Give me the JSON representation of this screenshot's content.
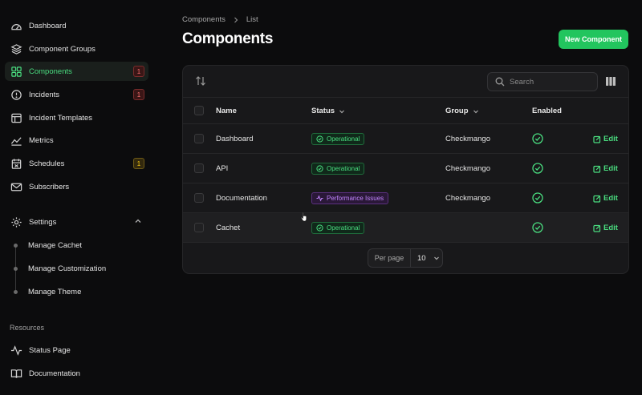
{
  "sidebar": {
    "items": [
      {
        "label": "Dashboard"
      },
      {
        "label": "Component Groups"
      },
      {
        "label": "Components",
        "badge": "1"
      },
      {
        "label": "Incidents",
        "badge": "1"
      },
      {
        "label": "Incident Templates"
      },
      {
        "label": "Metrics"
      },
      {
        "label": "Schedules",
        "badge": "1"
      },
      {
        "label": "Subscribers"
      }
    ],
    "settings": {
      "label": "Settings",
      "subitems": [
        {
          "label": "Manage Cachet"
        },
        {
          "label": "Manage Customization"
        },
        {
          "label": "Manage Theme"
        }
      ]
    },
    "resources": {
      "label": "Resources",
      "items": [
        {
          "label": "Status Page"
        },
        {
          "label": "Documentation"
        }
      ]
    }
  },
  "header": {
    "breadcrumb": [
      "Components",
      "List"
    ],
    "title": "Components",
    "new_button": "New Component"
  },
  "toolbar": {
    "search_placeholder": "Search"
  },
  "table": {
    "columns": [
      "Name",
      "Status",
      "Group",
      "Enabled"
    ],
    "rows": [
      {
        "name": "Dashboard",
        "status": "Operational",
        "group": "Checkmango",
        "enabled": true,
        "action": "Edit"
      },
      {
        "name": "API",
        "status": "Operational",
        "group": "Checkmango",
        "enabled": true,
        "action": "Edit"
      },
      {
        "name": "Documentation",
        "status": "Performance Issues",
        "group": "Checkmango",
        "enabled": true,
        "action": "Edit"
      },
      {
        "name": "Cachet",
        "status": "Operational",
        "group": "",
        "enabled": true,
        "action": "Edit"
      }
    ]
  },
  "pagination": {
    "label": "Per page",
    "value": "10"
  },
  "colors": {
    "accent": "#22c55e",
    "operational": "#4ade80",
    "performance": "#c084fc",
    "badge_red": "#f87171",
    "badge_yellow": "#facc15"
  }
}
